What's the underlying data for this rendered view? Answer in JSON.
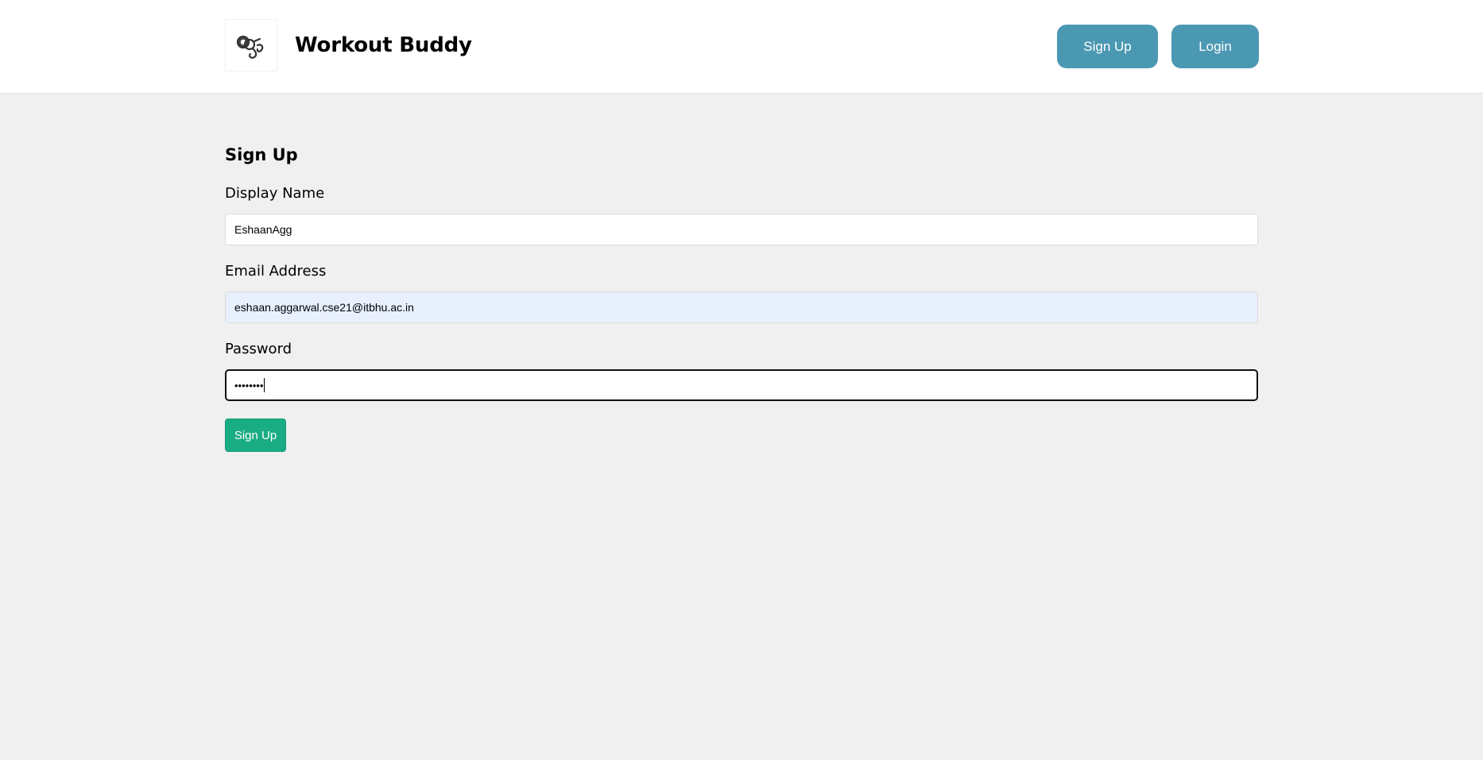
{
  "header": {
    "logo_icon": "dumbbell-logo-icon",
    "brand_title": "Workout Buddy",
    "nav": {
      "signup_label": "Sign Up",
      "login_label": "Login"
    }
  },
  "form": {
    "title": "Sign Up",
    "display_name": {
      "label": "Display Name",
      "value": "EshaanAgg"
    },
    "email": {
      "label": "Email Address",
      "value": "eshaan.aggarwal.cse21@itbhu.ac.in"
    },
    "password": {
      "label": "Password",
      "masked_value": "••••••••"
    },
    "submit_label": "Sign Up"
  },
  "colors": {
    "nav_button": "#4b98b3",
    "submit_button": "#1aac83",
    "page_background": "#f0f0f0",
    "autofill_background": "#e8f0fe"
  }
}
